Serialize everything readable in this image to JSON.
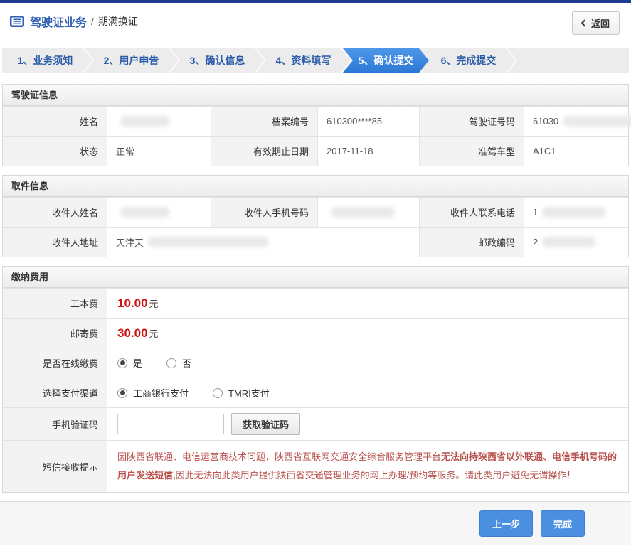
{
  "header": {
    "title": "驾驶证业务",
    "separator": "/",
    "subtitle": "期满换证",
    "back_label": "返回"
  },
  "steps": [
    {
      "label": "1、业务须知",
      "active": false
    },
    {
      "label": "2、用户申告",
      "active": false
    },
    {
      "label": "3、确认信息",
      "active": false
    },
    {
      "label": "4、资料填写",
      "active": false
    },
    {
      "label": "5、确认提交",
      "active": true
    },
    {
      "label": "6、完成提交",
      "active": false
    }
  ],
  "license_info": {
    "title": "驾驶证信息",
    "name_label": "姓名",
    "name_value": "",
    "file_no_label": "档案编号",
    "file_no_value": "610300****85",
    "license_no_label": "驾驶证号码",
    "license_no_value": "61030",
    "status_label": "状态",
    "status_value": "正常",
    "expiry_label": "有效期止日期",
    "expiry_value": "2017-11-18",
    "vehicle_class_label": "准驾车型",
    "vehicle_class_value": "A1C1"
  },
  "pickup_info": {
    "title": "取件信息",
    "recipient_name_label": "收件人姓名",
    "recipient_name_value": "",
    "recipient_mobile_label": "收件人手机号码",
    "recipient_mobile_value": "",
    "recipient_phone_label": "收件人联系电话",
    "recipient_phone_value": "1",
    "address_label": "收件人地址",
    "address_value": "天津天",
    "postcode_label": "邮政编码",
    "postcode_value": "2"
  },
  "payment": {
    "title": "缴纳费用",
    "work_fee_label": "工本费",
    "work_fee_amount": "10.00",
    "work_fee_unit": "元",
    "mail_fee_label": "邮寄费",
    "mail_fee_amount": "30.00",
    "mail_fee_unit": "元",
    "online_pay": {
      "label": "是否在线缴费",
      "options": [
        {
          "label": "是",
          "selected": true
        },
        {
          "label": "否",
          "selected": false
        }
      ]
    },
    "channel": {
      "label": "选择支付渠道",
      "options": [
        {
          "label": "工商银行支付",
          "selected": true
        },
        {
          "label": "TMRI支付",
          "selected": false
        }
      ]
    },
    "sms_code": {
      "label": "手机验证码",
      "input_value": "",
      "button_label": "获取验证码"
    },
    "sms_notice": {
      "label": "短信接收提示",
      "part1": "因陕西省联通、电信运营商技术问题，陕西省互联网交通安全综合服务管理平台",
      "part2": "无法向持陕西省以外联通、电信手机号码的用户发送短信,",
      "part3": "因此无法向此类用户提供陕西省交通管理业务的网上办理/预约等服务。请此类用户避免无谓操作！"
    }
  },
  "footer": {
    "prev_label": "上一步",
    "done_label": "完成"
  },
  "colors": {
    "topbar": "#1e3d8f",
    "title_blue": "#2f5eb3",
    "step_active": "#3b82dc",
    "fee_red": "#d01212",
    "notice_red": "#b8534e",
    "button_blue": "#4a8fe0"
  }
}
